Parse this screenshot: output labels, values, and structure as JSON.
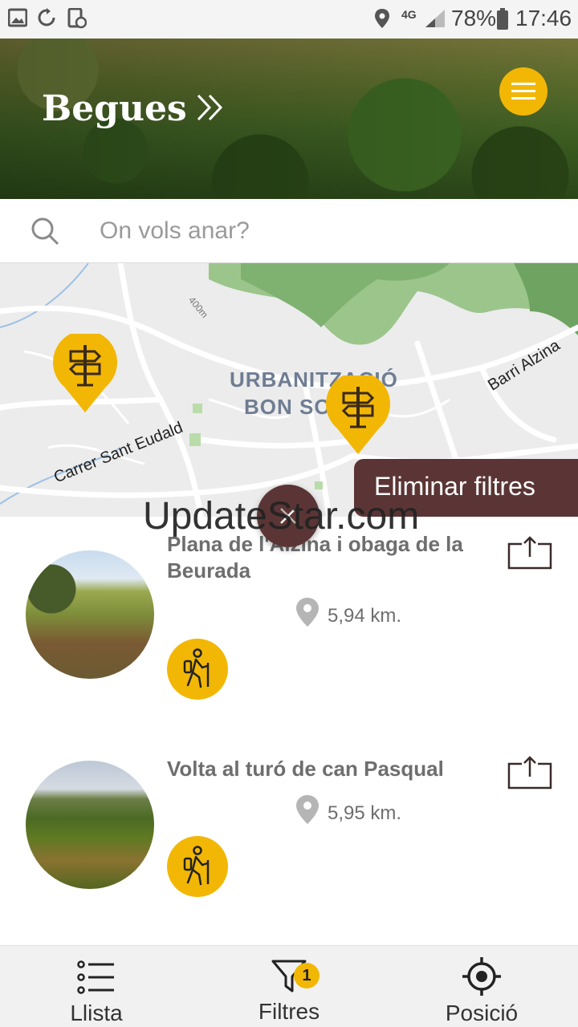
{
  "status_bar": {
    "network": "4G",
    "battery": "78%",
    "time": "17:46"
  },
  "header": {
    "town": "Begues"
  },
  "search": {
    "placeholder": "On vols anar?"
  },
  "map": {
    "area_label_1": "URBANITZACIÓ",
    "area_label_2": "BON SO",
    "street_1": "Carrer Sant Eudald",
    "street_2": "Barri Alzina",
    "contour": "400m"
  },
  "filters": {
    "clear_label": "Eliminar filtres"
  },
  "watermark": "UpdateStar.com",
  "routes": [
    {
      "name": "Plana de l'Alzina i obaga de la Beurada",
      "distance": "5,94 km."
    },
    {
      "name": "Volta al turó de can Pasqual",
      "distance": "5,95 km."
    }
  ],
  "bottom_nav": {
    "list_label": "Llista",
    "filters_label": "Filtres",
    "filters_count": "1",
    "position_label": "Posició"
  },
  "colors": {
    "accent": "#f2b705",
    "dark_brown": "#5b3535"
  }
}
